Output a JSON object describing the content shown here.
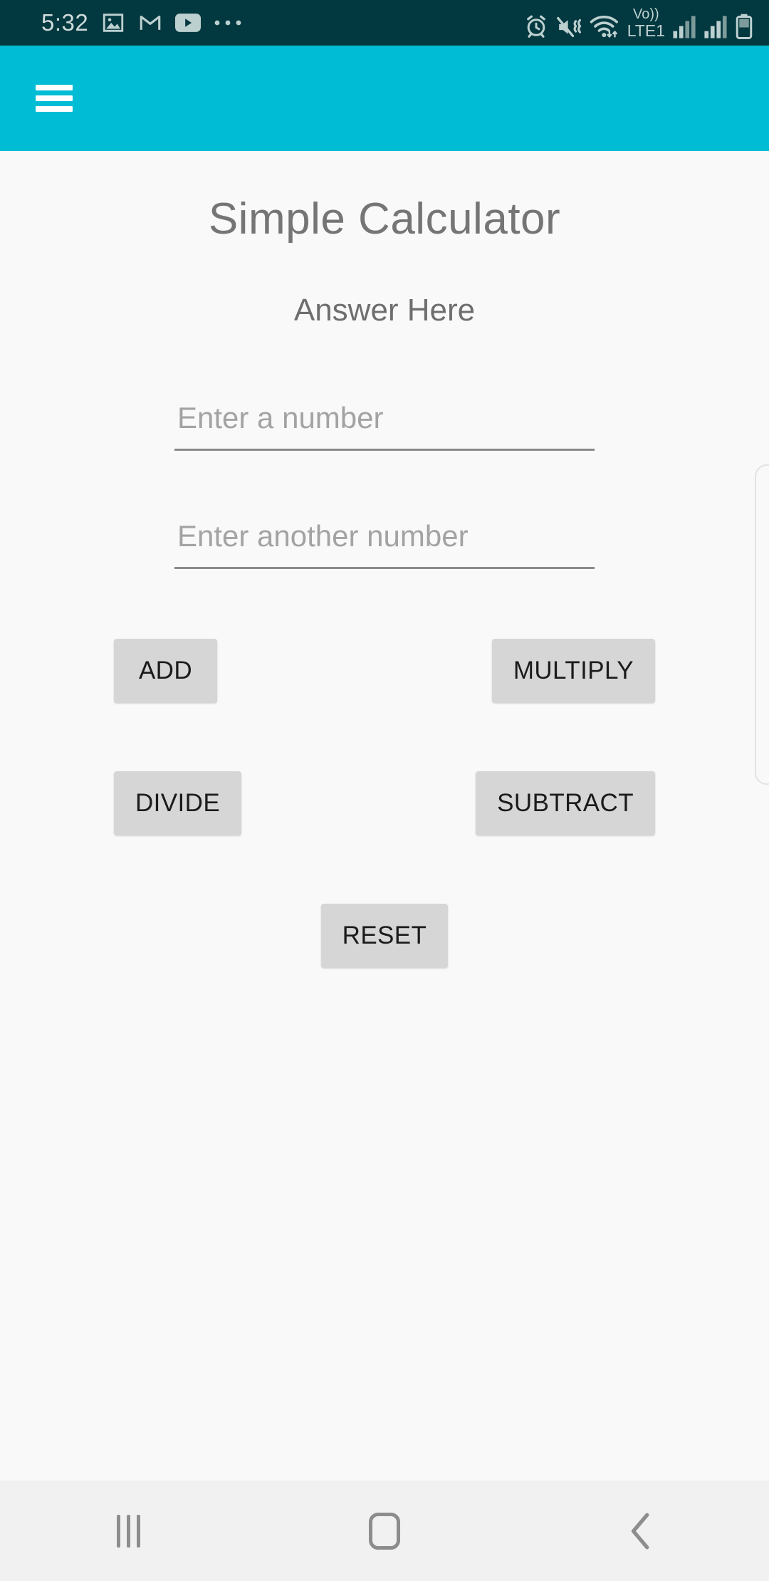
{
  "status_bar": {
    "time": "5:32",
    "left_icons": [
      "photos-icon",
      "gmail-icon",
      "youtube-icon",
      "more-dots-icon"
    ],
    "right_icons": [
      "alarm-icon",
      "vibrate-mute-icon",
      "wifi-icon",
      "volte-icon",
      "signal-sim1-icon",
      "signal-sim2-icon",
      "battery-icon"
    ],
    "network_label": "Vo))",
    "network_sub": "LTE1",
    "bg_color": "#02383f",
    "icon_color": "#bdd0d0"
  },
  "app_bar": {
    "menu_label": "menu",
    "bg_color": "#00bcd4"
  },
  "main": {
    "title": "Simple Calculator",
    "answer": "Answer Here",
    "inputs": [
      {
        "name": "first-number",
        "value": "",
        "placeholder": "Enter a number"
      },
      {
        "name": "second-number",
        "value": "",
        "placeholder": "Enter another number"
      }
    ],
    "buttons": {
      "add": "ADD",
      "multiply": "MULTIPLY",
      "divide": "DIVIDE",
      "subtract": "SUBTRACT",
      "reset": "RESET"
    },
    "bg_color": "#f9f9f9",
    "button_color": "#d6d6d6",
    "title_color": "#757575"
  },
  "nav_bar": {
    "recents_label": "recents",
    "home_label": "home",
    "back_label": "back",
    "bg_color": "#f1f1f1"
  }
}
